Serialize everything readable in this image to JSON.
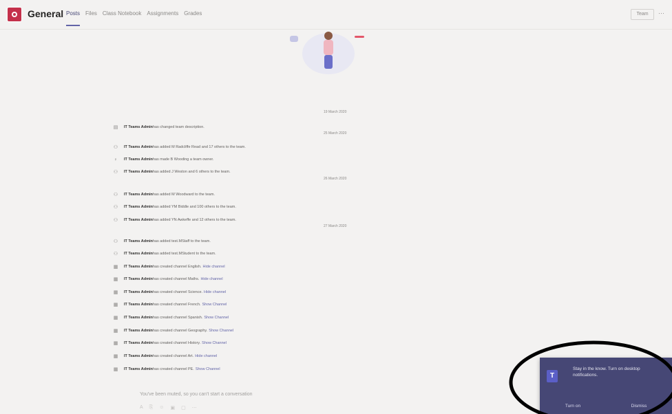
{
  "header": {
    "channel_name": "General",
    "tabs": [
      {
        "label": "Posts"
      },
      {
        "label": "Files"
      },
      {
        "label": "Class Notebook"
      },
      {
        "label": "Assignments"
      },
      {
        "label": "Grades"
      }
    ],
    "team_button_label": "Team",
    "more_icon": "more-icon"
  },
  "feed": [
    {
      "type": "date",
      "label": "19 March 2020"
    },
    {
      "type": "activity",
      "icon": "description-icon",
      "actor": "IT Teams Admin",
      "text": " has changed team description."
    },
    {
      "type": "date",
      "label": "25 March 2020"
    },
    {
      "type": "activity",
      "icon": "people-add-icon",
      "actor": "IT Teams Admin",
      "text": " has added M Radcliffe Read and 17 others to the team."
    },
    {
      "type": "activity",
      "icon": "person-icon",
      "actor": "IT Teams Admin",
      "text": " has made B Wooding a team owner."
    },
    {
      "type": "activity",
      "icon": "people-add-icon",
      "actor": "IT Teams Admin",
      "text": " has added J Weston and 6 others to the team."
    },
    {
      "type": "date",
      "label": "26 March 2020"
    },
    {
      "type": "activity",
      "icon": "people-add-icon",
      "actor": "IT Teams Admin",
      "text": " has added M Woodward to the team."
    },
    {
      "type": "activity",
      "icon": "people-add-icon",
      "actor": "IT Teams Admin",
      "text": " has added YM Biddle and 100 others to the team."
    },
    {
      "type": "activity",
      "icon": "people-add-icon",
      "actor": "IT Teams Admin",
      "text": " has added YN Awkeffe and 12 others to the team."
    },
    {
      "type": "date",
      "label": "27 March 2020"
    },
    {
      "type": "activity",
      "icon": "people-add-icon",
      "actor": "IT Teams Admin",
      "text": " has added test.MStaff to the team."
    },
    {
      "type": "activity",
      "icon": "people-add-icon",
      "actor": "IT Teams Admin",
      "text": " has added test.MStudent to the team."
    },
    {
      "type": "activity",
      "icon": "channel-icon",
      "actor": "IT Teams Admin",
      "text": " has created channel English.",
      "link": "Hide channel"
    },
    {
      "type": "activity",
      "icon": "channel-icon",
      "actor": "IT Teams Admin",
      "text": " has created channel Maths.",
      "link": "Hide channel"
    },
    {
      "type": "activity",
      "icon": "channel-icon",
      "actor": "IT Teams Admin",
      "text": " has created channel Science.",
      "link": "Hide channel"
    },
    {
      "type": "activity",
      "icon": "channel-icon",
      "actor": "IT Teams Admin",
      "text": " has created channel French.",
      "link": "Show Channel"
    },
    {
      "type": "activity",
      "icon": "channel-icon",
      "actor": "IT Teams Admin",
      "text": " has created channel Spanish.",
      "link": "Show Channel"
    },
    {
      "type": "activity",
      "icon": "channel-icon",
      "actor": "IT Teams Admin",
      "text": " has created channel Geography.",
      "link": "Show Channel"
    },
    {
      "type": "activity",
      "icon": "channel-icon",
      "actor": "IT Teams Admin",
      "text": " has created channel History.",
      "link": "Show Channel"
    },
    {
      "type": "activity",
      "icon": "channel-icon",
      "actor": "IT Teams Admin",
      "text": " has created channel Art.",
      "link": "Hide channel"
    },
    {
      "type": "activity",
      "icon": "channel-icon",
      "actor": "IT Teams Admin",
      "text": " has created channel PE.",
      "link": "Show Channel"
    }
  ],
  "compose": {
    "message": "You've been muted, so you can't start a conversation",
    "icons": [
      "format-icon",
      "attach-icon",
      "emoji-icon",
      "gif-icon",
      "sticker-icon",
      "more-options-icon"
    ]
  },
  "toast": {
    "logo_letter": "T",
    "message": "Stay in the know. Turn on desktop notifications.",
    "turn_on_label": "Turn on",
    "dismiss_label": "Dismiss"
  },
  "colors": {
    "brand": "#6264a7",
    "toast_bg": "#464775",
    "team_avatar": "#c4314b",
    "annotation": "#000000"
  }
}
